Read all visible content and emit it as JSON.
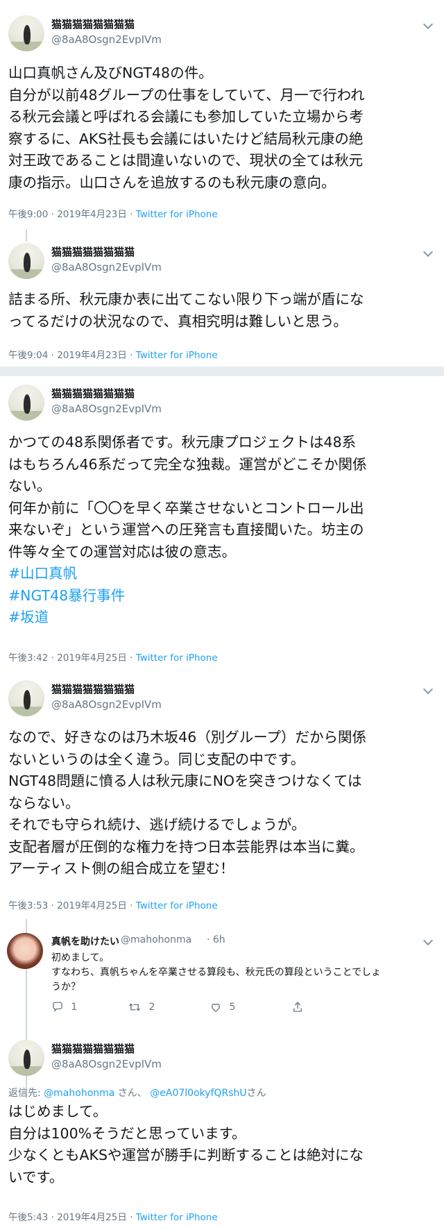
{
  "tweets": [
    {
      "name": "猫猫猫猫猫猫猫猫",
      "handle": "@8aA8Osgn2EvpIVm",
      "lines": [
        "山口真帆さん及びNGT48の件。",
        "自分が以前48グループの仕事をしていて、月一で行われ",
        "る秋元会議と呼ばれる会議にも参加していた立場から考",
        "察するに、AKS社長も会議にはいたけど結局秋元康の絶",
        "対王政であることは間違いないので、現状の全ては秋元",
        "康の指示。山口さんを追放するのも秋元康の意向。"
      ],
      "time": "午後9:00 · 2019年4月23日 · ",
      "source": "Twitter for iPhone"
    },
    {
      "name": "猫猫猫猫猫猫猫猫",
      "handle": "@8aA8Osgn2EvpIVm",
      "lines": [
        "詰まる所、秋元康か表に出てこない限り下っ端が盾にな",
        "ってるだけの状況なので、真相究明は難しいと思う。"
      ],
      "time": "午後9:04 · 2019年4月23日 · ",
      "source": "Twitter for iPhone"
    },
    {
      "name": "猫猫猫猫猫猫猫猫",
      "handle": "@8aA8Osgn2EvpIVm",
      "lines": [
        "かつての48系関係者です。秋元康プロジェクトは48系",
        "はもちろん46系だって完全な独裁。運営がどこそか関係",
        "ない。",
        "何年か前に「〇〇を早く卒業させないとコントロール出",
        "来ないぞ」という運営への圧発言も直接聞いた。坊主の",
        "件等々全ての運営対応は彼の意志。"
      ],
      "hashtags": [
        "#山口真帆",
        "#NGT48暴行事件",
        "#坂道"
      ],
      "time": "午後3:42 · 2019年4月25日 · ",
      "source": "Twitter for iPhone"
    },
    {
      "name": "猫猫猫猫猫猫猫猫",
      "handle": "@8aA8Osgn2EvpIVm",
      "lines": [
        "なので、好きなのは乃木坂46（別グループ）だから関係",
        "ないというのは全く違う。同じ支配の中です。",
        "NGT48問題に憤る人は秋元康にNOを突きつけなくては",
        "ならない。",
        "それでも守られ続け、逃げ続けるでしょうが。",
        "支配者層が圧倒的な権力を持つ日本芸能界は本当に糞。",
        "アーティスト側の組合成立を望む！"
      ],
      "time": "午後3:53 · 2019年4月25日 · ",
      "source": "Twitter for iPhone"
    },
    {
      "name": "猫猫猫猫猫猫猫猫",
      "handle": "@8aA8Osgn2EvpIVm",
      "reply_prefix": "返信先: ",
      "reply_user1": "@mahohonma",
      "reply_mid": " さん、 ",
      "reply_user2": "@eA07l0okyfQRshU",
      "reply_suffix": "さん",
      "lines": [
        "はじめまして。",
        "自分は100%そうだと思っています。",
        "少なくともAKSや運営が勝手に判断することは絶対にな",
        "いです。"
      ],
      "time": "午後5:43 · 2019年4月25日 · ",
      "source": "Twitter for iPhone"
    }
  ],
  "reply": {
    "name": "真帆を助けたい",
    "handle": "@mahohonma",
    "age": "· 6h",
    "lines": [
      "初めまして。",
      "すなわち、真帆ちゃんを卒業させる算段も、秋元氏の算段ということでしょ",
      "うか？"
    ],
    "replies": "1",
    "retweets": "2",
    "likes": "5"
  },
  "icons": {
    "menu": "chevron-down-icon",
    "reply": "reply-icon",
    "retweet": "retweet-icon",
    "like": "heart-icon",
    "share": "share-icon"
  },
  "colors": {
    "link": "#1da1f2",
    "secondary": "#657786",
    "divider": "#e6ecf0"
  }
}
